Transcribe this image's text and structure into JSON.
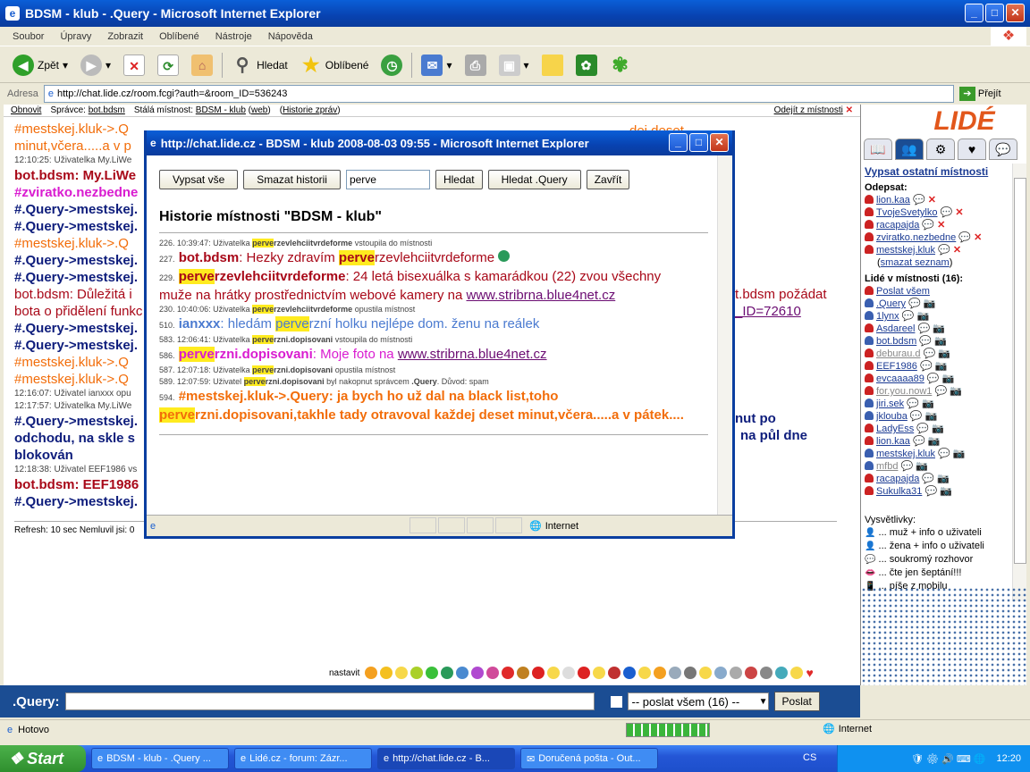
{
  "window": {
    "title": "BDSM - klub - .Query - Microsoft Internet Explorer"
  },
  "menu": [
    "Soubor",
    "Úpravy",
    "Zobrazit",
    "Oblíbené",
    "Nástroje",
    "Nápověda"
  ],
  "toolbar": {
    "back": "Zpět",
    "search": "Hledat",
    "favorites": "Oblíbené"
  },
  "address": {
    "label": "Adresa",
    "url": "http://chat.lide.cz/room.fcgi?auth=&room_ID=536243",
    "go": "Přejít"
  },
  "topbar": {
    "refresh": "Obnovit",
    "admin_label": "Správce:",
    "admin": "bot.bdsm",
    "room_label": "Stálá místnost:",
    "room": "BDSM - klub",
    "web": "web",
    "history": "Historie zpráv",
    "leave": "Odejít z místnosti"
  },
  "chat": [
    {
      "cls": "c-or",
      "text": "#mestskej.kluk->.Q"
    },
    {
      "cls": "c-or",
      "text": "minut,včera.....a v p"
    },
    {
      "cls": "c-sm",
      "text": "12:10:25: Uživatelka My.LiWe"
    },
    {
      "cls": "c-rd",
      "text": "bot.bdsm: My.LiWe"
    },
    {
      "cls": "c-mg",
      "text": "#zviratko.nezbedne"
    },
    {
      "cls": "c-nv",
      "text": "#.Query->mestskej."
    },
    {
      "cls": "c-nv",
      "text": "#.Query->mestskej."
    },
    {
      "cls": "c-or",
      "text": "#mestskej.kluk->.Q"
    },
    {
      "cls": "c-nv",
      "text": "#.Query->mestskej."
    },
    {
      "cls": "c-nv",
      "text": "#.Query->mestskej."
    },
    {
      "cls": "c-rn",
      "text": "bot.bdsm: Důležitá i"
    },
    {
      "cls": "c-rn",
      "text": "bota o přidělení funkc"
    },
    {
      "cls": "c-nv",
      "text": "#.Query->mestskej."
    },
    {
      "cls": "c-nv",
      "text": "#.Query->mestskej."
    },
    {
      "cls": "c-or",
      "text": "#mestskej.kluk->.Q"
    },
    {
      "cls": "c-or",
      "text": "#mestskej.kluk->.Q"
    },
    {
      "cls": "c-sm",
      "text": "12:16:07: Uživatel ianxxx opu"
    },
    {
      "cls": "c-sm",
      "text": "12:17:57: Uživatelka My.LiWe"
    },
    {
      "cls": "c-nv",
      "text": "#.Query->mestskej."
    },
    {
      "cls": "c-nv",
      "text": "odchodu, na skle s"
    },
    {
      "cls": "c-nv",
      "text": "blokován"
    },
    {
      "cls": "c-sm",
      "text": "12:18:38: Uživatel EEF1986 vs"
    },
    {
      "cls": "c-rd",
      "text": "bot.bdsm: EEF1986"
    },
    {
      "cls": "c-nv",
      "text": "#.Query->mestskej."
    }
  ],
  "chat_right": {
    "l1": "dej deset",
    "l2": "t.bdsm požádat",
    "l3": "_ID=72610",
    "l4": "nut po",
    "l5": "na půl dne"
  },
  "refresh_line": "Refresh: 10 sec   Nemluvil jsi: 0",
  "smileys_label": "nastavit",
  "input": {
    "label": ".Query:",
    "recipient": "-- poslat všem (16) --",
    "send": "Poslat"
  },
  "sidebar": {
    "logo": "LIDÉ",
    "other_rooms": "Vypsat ostatní místnosti",
    "left_label": "Odepsat:",
    "left_users": [
      "lion.kaa",
      "TvojeSvetylko",
      "racapajda",
      "zviratko.nezbedne",
      "mestskej.kluk"
    ],
    "clear_list": "smazat seznam",
    "in_room_label": "Lidé v místnosti (16):",
    "send_all": "Poslat všem",
    "users": [
      ".Query",
      "1lynx",
      "Asdareel",
      "bot.bdsm",
      "deburau.d",
      "EEF1986",
      "evcaaaa89",
      "for.you.now1",
      "jiri.sek",
      "jklouba",
      "LadyEss",
      "lion.kaa",
      "mestskej.kluk",
      "mfbd",
      "racapajda",
      "Sukulka31"
    ],
    "legend_label": "Vysvětlivky:",
    "legend": [
      "... muž + info o uživateli",
      "... žena + info o uživateli",
      "... soukromý rozhovor",
      "... čte jen šeptání!!!",
      "... píše z mobilu"
    ]
  },
  "status": {
    "text": "Hotovo",
    "zone": "Internet"
  },
  "taskbar": {
    "start": "Start",
    "tasks": [
      "BDSM - klub - .Query ...",
      "Lidé.cz - forum: Zázr...",
      "http://chat.lide.cz - B...",
      "Doručená pošta - Out..."
    ],
    "lang": "CS",
    "time": "12:20"
  },
  "popup": {
    "title": "http://chat.lide.cz - BDSM - klub 2008-08-03 09:55 - Microsoft Internet Explorer",
    "btn_all": "Vypsat vše",
    "btn_clear": "Smazat historii",
    "search_value": "perve",
    "btn_search": "Hledat",
    "btn_search_query": "Hledat .Query",
    "btn_close": "Zavřít",
    "heading": "Historie místnosti \"BDSM - klub\"",
    "status_zone": "Internet",
    "log": {
      "l226_num": "226.",
      "l226_pre": "10:39:47: Uživatelka",
      "l226_hl": "perve",
      "l226_nick": "rzevlehciitvrdeforme",
      "l226_post": "vstoupila do místnosti",
      "l227_num": "227.",
      "l227_nick": "bot.bdsm",
      "l227_a": ": Hezky zdravím",
      "l227_hl": "perve",
      "l227_b": "rzevlehciitvrdeforme",
      "l229_num": "229.",
      "l229_hl": "perve",
      "l229_nick": "rzevlehciitvrdeforme",
      "l229_msg": ": 24 letá bisexuálka s kamarádkou (22) zvou všechny muže na hrátky prostřednictvím webové kamery na",
      "l229_link": "www.stribrna.blue4net.cz",
      "l230_num": "230.",
      "l230_pre": "10:40:06: Uživatelka",
      "l230_hl": "perve",
      "l230_nick": "rzevlehciitvrdeforme",
      "l230_post": "opustila místnost",
      "l510_num": "510.",
      "l510_nick": "ianxxx",
      "l510_a": ": hledám",
      "l510_hl": "perve",
      "l510_b": "rzní holku nejlépe dom. ženu na reálek",
      "l583_num": "583.",
      "l583_pre": "12:06:41: Uživatelka",
      "l583_hl": "perve",
      "l583_nick": "rzni.dopisovani",
      "l583_post": "vstoupila do místnosti",
      "l586_num": "586.",
      "l586_hl": "perve",
      "l586_nick": "rzni.dopisovani",
      "l586_msg": ": Moje foto na",
      "l586_link": "www.stribrna.blue4net.cz",
      "l587_num": "587.",
      "l587_pre": "12:07:18: Uživatelka",
      "l587_hl": "perve",
      "l587_nick": "rzni.dopisovani",
      "l587_post": "opustila místnost",
      "l589_num": "589.",
      "l589_pre": "12:07:59: Uživatel",
      "l589_hl": "perve",
      "l589_nick": "rzni.dopisovani",
      "l589_post": "byl nakopnut správcem",
      "l589_admin": ".Query",
      "l589_reason": ". Důvod: spam",
      "l594_num": "594.",
      "l594_a": "#mestskej.kluk->.Query: ja bych ho už dal na black list,toho",
      "l594_hl": "perve",
      "l594_b": "rzni.dopisovani,takhle tady otravoval každej deset minut,včera.....a v pátek...."
    }
  }
}
